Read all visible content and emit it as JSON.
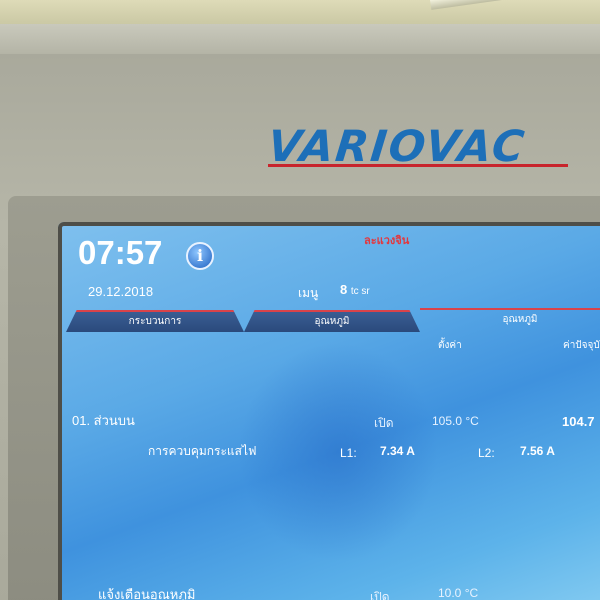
{
  "brand": {
    "logo_text": "VARIOVAC",
    "logo_color": "#1d6fb8",
    "accent_line_color": "#c8242c"
  },
  "status_bar": {
    "time": "07:57",
    "info_icon": "info-icon",
    "status_text": "ละแวงจิน",
    "date": "29.12.2018",
    "menu_label": "เมนู",
    "menu_value": "8",
    "menu_unit": "tc sr"
  },
  "tabs": [
    {
      "label": "กระบวนการ"
    },
    {
      "label": "อุณหภูมิ"
    },
    {
      "label": "อุณหภูมิ"
    }
  ],
  "column_headers": {
    "set": "ตั้งค่า",
    "actual": "ค่าปัจจุบั"
  },
  "zone": {
    "label": "01. ส่วนบน",
    "state": "เปิด",
    "set_value": "105.0 °C",
    "actual_value": "104.7",
    "current_control_label": "การควบคุมกระแสไฟ",
    "l1_label": "L1:",
    "l1_value": "7.34 A",
    "l2_label": "L2:",
    "l2_value": "7.56 A"
  },
  "alarm": {
    "label": "แจ้งเตือนอุณหภูมิ",
    "state": "เปิด",
    "value": "10.0 °C"
  }
}
